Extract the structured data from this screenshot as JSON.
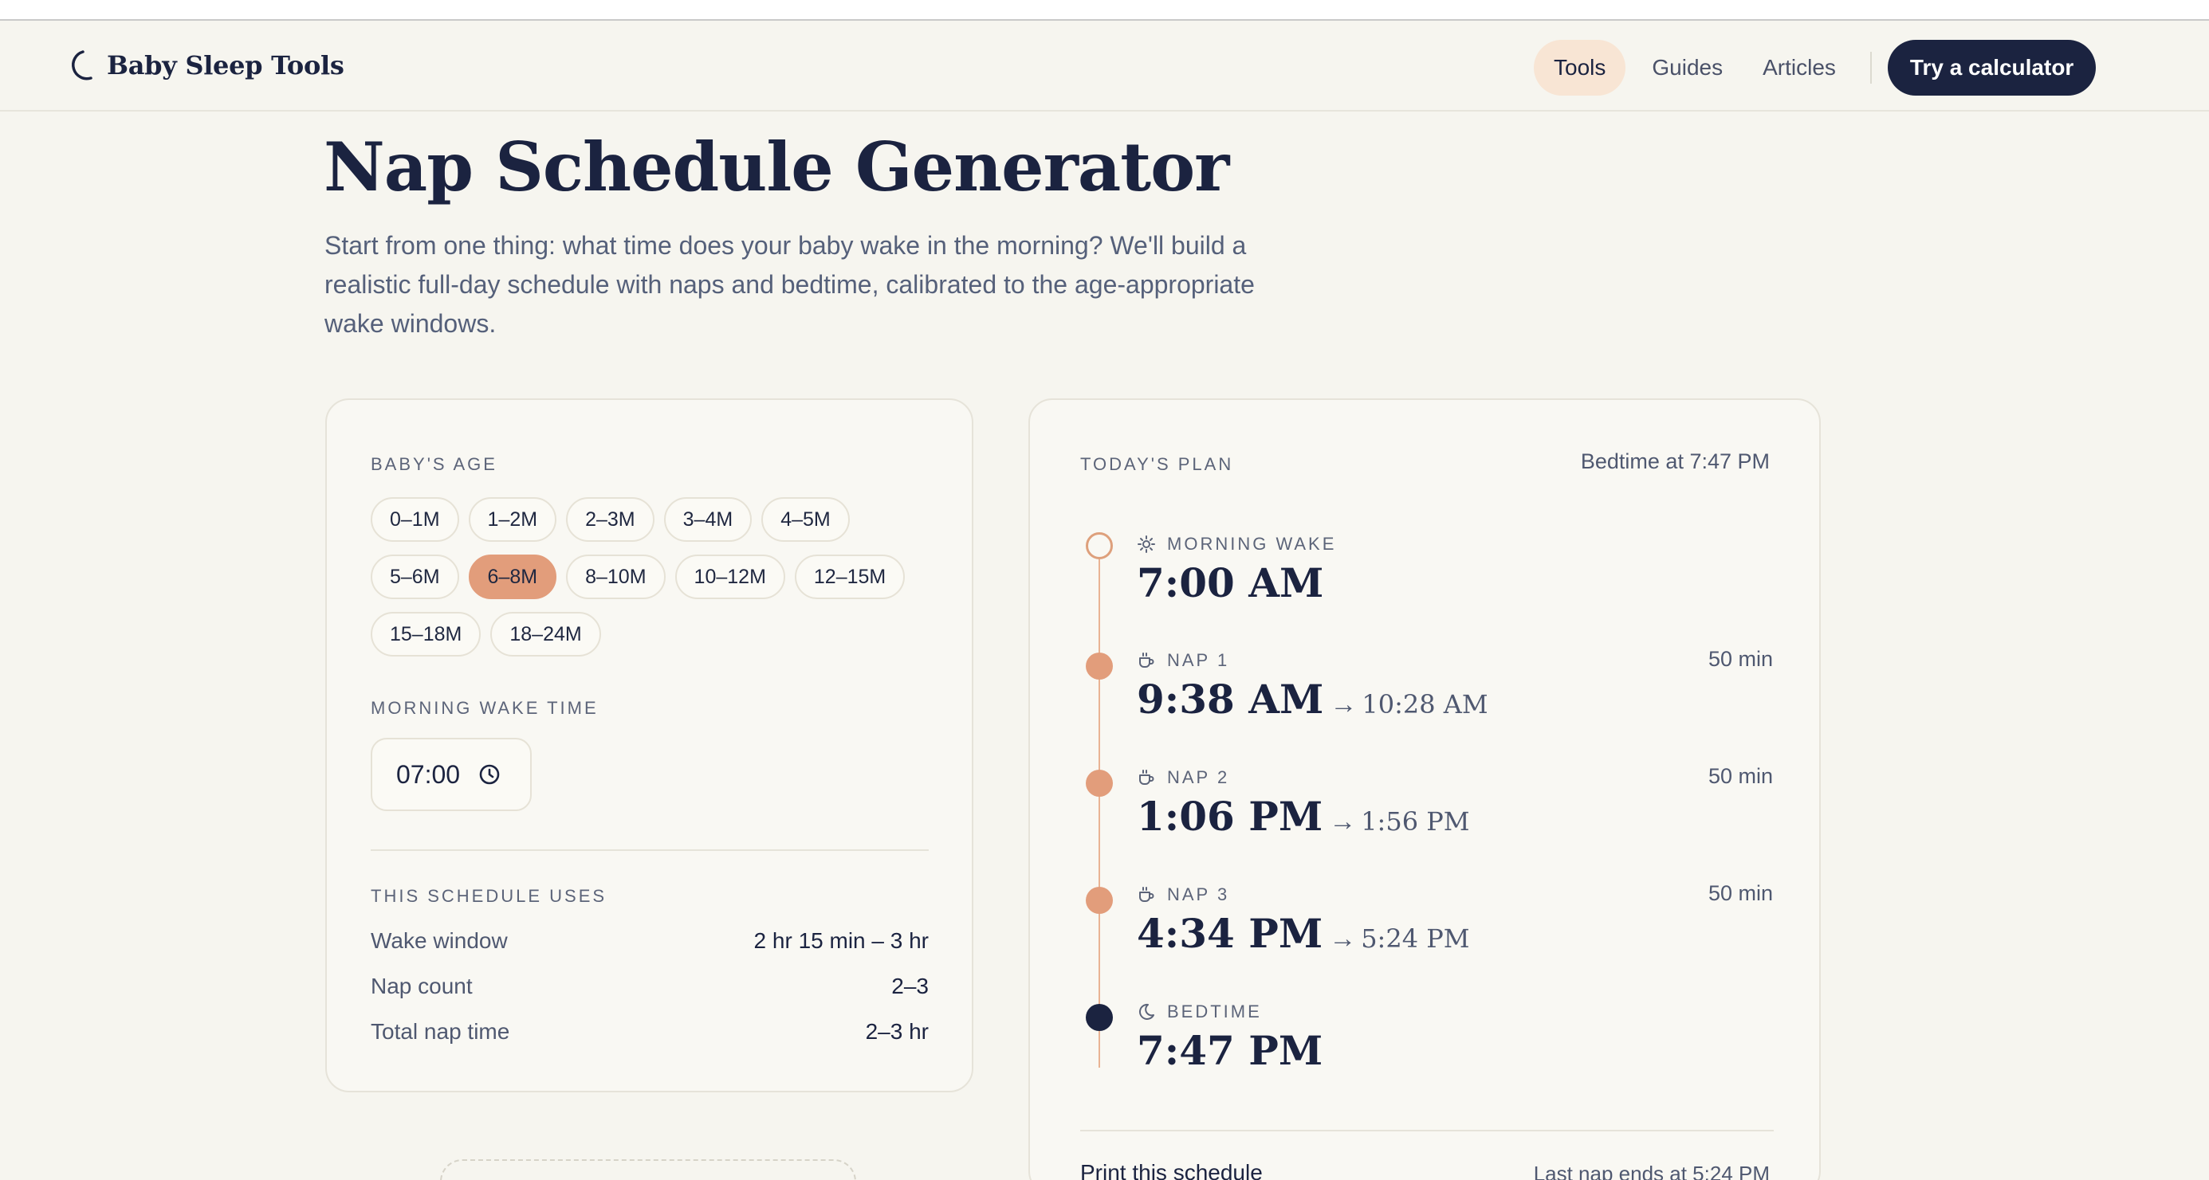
{
  "header": {
    "brand": "Baby Sleep Tools",
    "nav": [
      "Tools",
      "Guides",
      "Articles"
    ],
    "cta": "Try a calculator"
  },
  "hero": {
    "title": "Nap Schedule Generator",
    "intro": "Start from one thing: what time does your baby wake in the morning? We'll build a realistic full-day schedule with naps and bedtime, calibrated to the age-appropriate wake windows."
  },
  "settings": {
    "age_label": "BABY'S AGE",
    "ages": [
      [
        "0–1M",
        "1–2M",
        "2–3M",
        "3–4M",
        "4–5M"
      ],
      [
        "5–6M",
        "6–8M",
        "8–10M",
        "10–12M",
        "12–15M"
      ],
      [
        "15–18M",
        "18–24M"
      ]
    ],
    "selected_age": "6–8M",
    "wake_label": "MORNING WAKE TIME",
    "wake_time": "07:00",
    "uses_label": "THIS SCHEDULE USES",
    "uses": [
      {
        "key": "Wake window",
        "value": "2 hr 15 min – 3 hr"
      },
      {
        "key": "Nap count",
        "value": "2–3"
      },
      {
        "key": "Total nap time",
        "value": "2–3 hr"
      }
    ]
  },
  "plan": {
    "label": "TODAY'S PLAN",
    "bedtime_summary": "Bedtime at 7:47 PM",
    "items": [
      {
        "icon": "sun-icon",
        "kind": "MORNING WAKE",
        "time": "7:00 AM",
        "end": "",
        "duration": ""
      },
      {
        "icon": "cup-icon",
        "kind": "NAP 1",
        "time": "9:38 AM",
        "end": "10:28 AM",
        "duration": "50 min"
      },
      {
        "icon": "cup-icon",
        "kind": "NAP 2",
        "time": "1:06 PM",
        "end": "1:56 PM",
        "duration": "50 min"
      },
      {
        "icon": "cup-icon",
        "kind": "NAP 3",
        "time": "4:34 PM",
        "end": "5:24 PM",
        "duration": "50 min"
      },
      {
        "icon": "moon-icon",
        "kind": "BEDTIME",
        "time": "7:47 PM",
        "end": "",
        "duration": ""
      }
    ],
    "print": "Print this schedule",
    "last_nap": "Last nap ends at 5:24 PM"
  },
  "colors": {
    "background": "#f6f5ef",
    "navy": "#1b2340",
    "accent": "#e29d7b",
    "active_nav": "#f8e5d4"
  }
}
